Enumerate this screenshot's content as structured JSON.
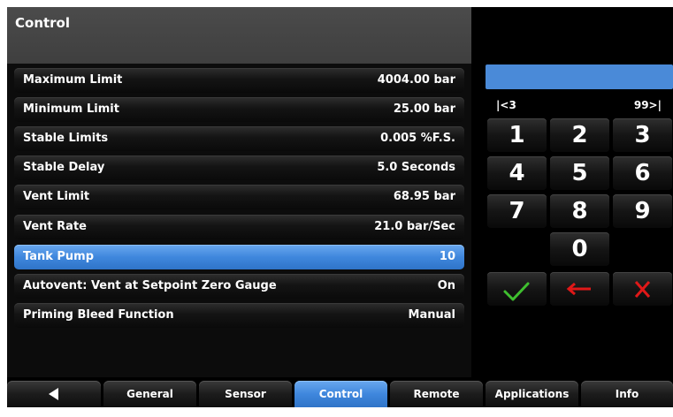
{
  "header": {
    "title": "Control"
  },
  "settings": [
    {
      "label": "Maximum Limit",
      "value": "4004.00 bar"
    },
    {
      "label": "Minimum Limit",
      "value": "25.00 bar"
    },
    {
      "label": "Stable Limits",
      "value": "0.005 %F.S."
    },
    {
      "label": "Stable Delay",
      "value": "5.0 Seconds"
    },
    {
      "label": "Vent Limit",
      "value": "68.95 bar"
    },
    {
      "label": "Vent Rate",
      "value": "21.0 bar/Sec"
    },
    {
      "label": "Tank Pump",
      "value": "10",
      "selected": true
    },
    {
      "label": "Autovent: Vent at Setpoint Zero Gauge",
      "value": "On"
    },
    {
      "label": "Priming Bleed Function",
      "value": "Manual"
    }
  ],
  "keypad": {
    "entry_value": "",
    "range_min": "|<3",
    "range_max": "99>|",
    "keys": [
      "1",
      "2",
      "3",
      "4",
      "5",
      "6",
      "7",
      "8",
      "9",
      "0"
    ],
    "confirm_icon": "checkmark-icon",
    "backspace_icon": "left-arrow-icon",
    "cancel_icon": "x-icon",
    "colors": {
      "confirm": "#3fbf2f",
      "backspace": "#e01818",
      "cancel": "#e01818"
    }
  },
  "tabs": {
    "back_icon": "back-triangle-icon",
    "items": [
      "General",
      "Sensor",
      "Control",
      "Remote",
      "Applications",
      "Info"
    ],
    "active": "Control"
  },
  "colors": {
    "accent": "#3f87dd",
    "entry": "#4a8ad8"
  }
}
